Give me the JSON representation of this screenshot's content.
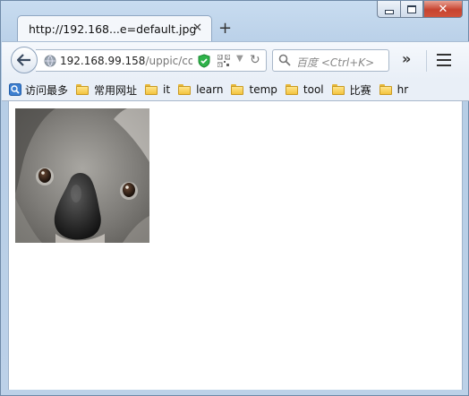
{
  "window": {
    "minimize_label": "",
    "maximize_label": "",
    "close_label": "✕"
  },
  "tab": {
    "title": "http://192.168...e=default.jpg",
    "close": "✕",
    "new_tab": "+"
  },
  "navbar": {
    "url_host": "192.168.99.158",
    "url_rest": "/uppic/cor",
    "reload": "↻",
    "dropdown": "▼",
    "search_placeholder": "百度 <Ctrl+K>",
    "overflow": "»"
  },
  "bookmarks": {
    "items": [
      {
        "label": "访问最多",
        "icon": "most-visited-icon"
      },
      {
        "label": "常用网址",
        "icon": "folder-icon"
      },
      {
        "label": "it",
        "icon": "folder-icon"
      },
      {
        "label": "learn",
        "icon": "folder-icon"
      },
      {
        "label": "temp",
        "icon": "folder-icon"
      },
      {
        "label": "tool",
        "icon": "folder-icon"
      },
      {
        "label": "比赛",
        "icon": "folder-icon"
      },
      {
        "label": "hr",
        "icon": "folder-icon"
      }
    ]
  },
  "content": {
    "image_icon": "koala-photo"
  },
  "colors": {
    "frame": "#bcd3ea",
    "close_button": "#c7432f",
    "folder": "#f3c33e"
  }
}
